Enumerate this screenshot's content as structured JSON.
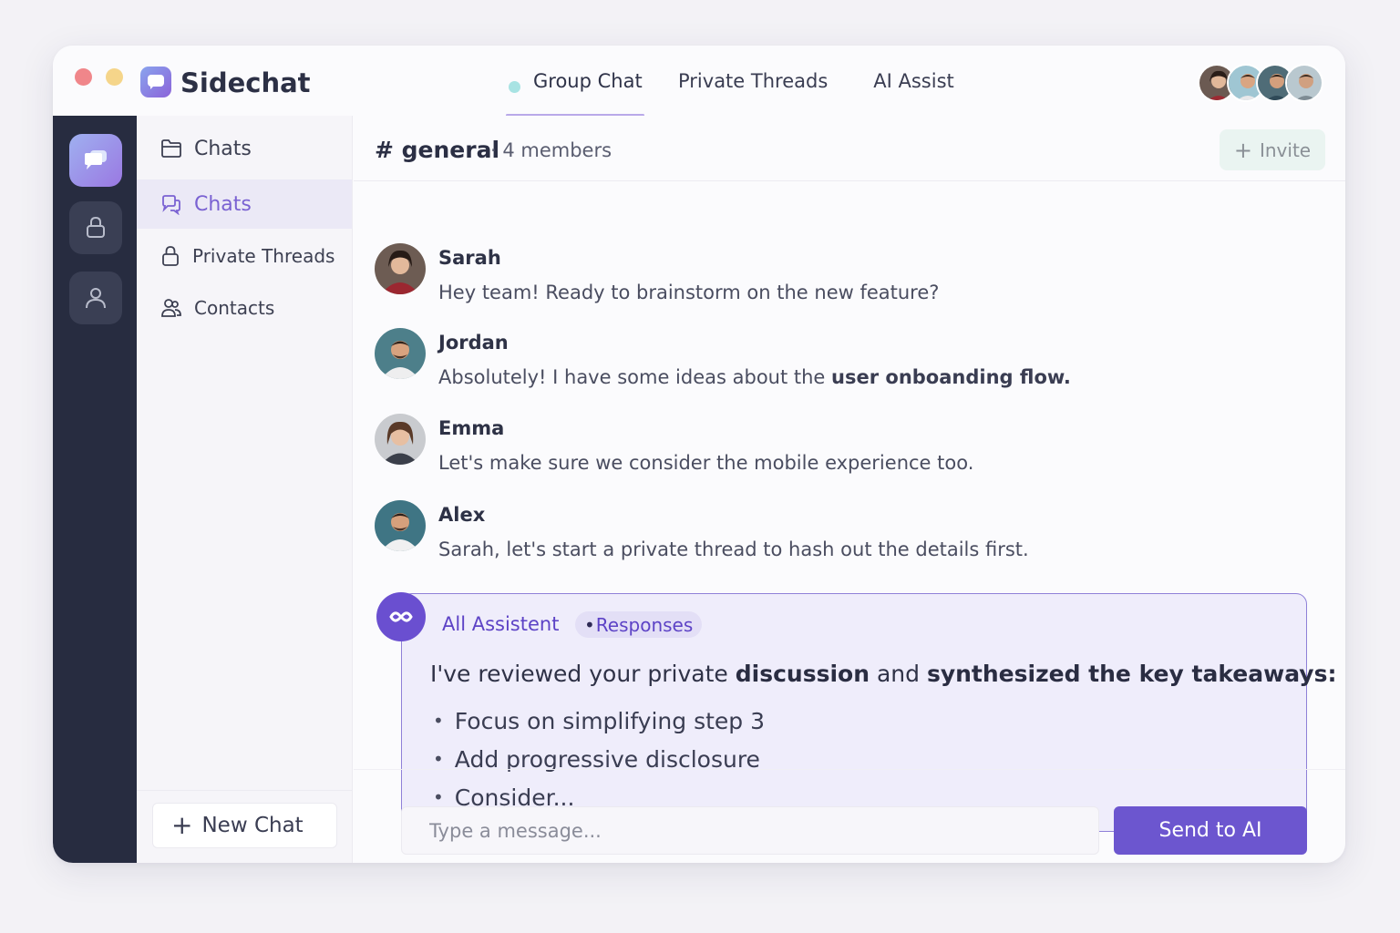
{
  "window": {
    "app_title": "Sidechat"
  },
  "top_tabs": [
    {
      "label": "Group Chat",
      "active": true
    },
    {
      "label": "Private Threads",
      "active": false
    },
    {
      "label": "AI Assist",
      "active": false
    }
  ],
  "rail": {
    "icons": [
      "chat-bubble-icon",
      "lock-icon",
      "user-icon"
    ]
  },
  "sidebar": {
    "items": [
      {
        "label": "Chats",
        "icon": "folder-icon"
      },
      {
        "label": "Chats",
        "icon": "chat-bubble-icon",
        "active": true
      },
      {
        "label": "Private Threads",
        "icon": "lock-icon"
      },
      {
        "label": "Contacts",
        "icon": "contacts-icon"
      }
    ],
    "new_chat_label": "New Chat"
  },
  "channel": {
    "name": "# general",
    "meta": "· 4 members",
    "invite_label": "Invite"
  },
  "messages": [
    {
      "name": "Sarah",
      "text": "Hey team! Ready to brainstorm on the new feature?"
    },
    {
      "name": "Jordan",
      "text_before": "Absolutely! I have some ideas about the ",
      "text_bold": "user onboanding flow."
    },
    {
      "name": "Emma",
      "text": "Let's make sure we consider the mobile experience too."
    },
    {
      "name": "Alex",
      "text": "Sarah, let's start a private thread to hash out the details first."
    }
  ],
  "ai": {
    "name": "All Assistent",
    "tag_bullet": "•",
    "tag": "Responses",
    "body_1": "I've reviewed your private ",
    "body_bold_1": "discussion",
    "body_2": " and ",
    "body_bold_2": "synthesized the key takeaways:",
    "points": [
      "Focus on simplifying step 3",
      "Add progressive disclosure",
      "Consider..."
    ]
  },
  "composer": {
    "placeholder": "Type a message...",
    "send_label": "Send to AI"
  },
  "colors": {
    "accent": "#6c56cf",
    "rail_bg": "#272c40",
    "ai_card_bg": "#efedfb",
    "ai_border": "#8f80d8"
  }
}
